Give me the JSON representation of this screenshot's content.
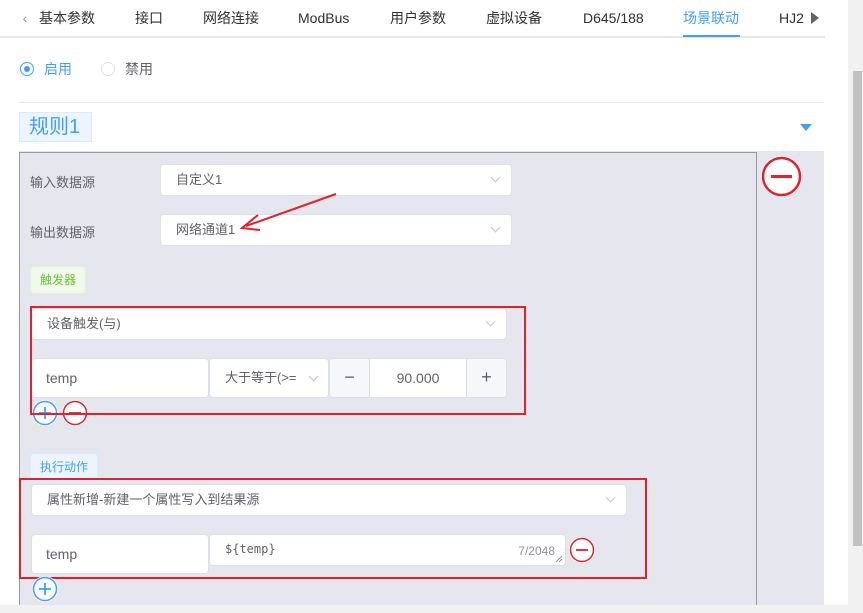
{
  "tabs": {
    "items": [
      "基本参数",
      "接口",
      "网络连接",
      "ModBus",
      "用户参数",
      "虚拟设备",
      "D645/188",
      "场景联动",
      "HJ2"
    ],
    "active": "场景联动"
  },
  "status": {
    "enabled_label": "启用",
    "disabled_label": "禁用"
  },
  "rule": {
    "title": "规则1",
    "input_source_label": "输入数据源",
    "input_source_value": "自定义1",
    "output_source_label": "输出数据源",
    "output_source_value": "网络通道1",
    "trigger": {
      "tag": "触发器",
      "type_value": "设备触发(与)",
      "field": "temp",
      "operator": "大于等于(>=",
      "value": "90.000",
      "minus_label": "−",
      "plus_label": "+"
    },
    "action": {
      "tag": "执行动作",
      "type_value": "属性新增-新建一个属性写入到结果源",
      "field": "temp",
      "expression": "${temp}",
      "char_count": "7/2048"
    }
  },
  "colors": {
    "accent": "#409eff",
    "success": "#67c23a",
    "annotation_red": "#e3202b"
  }
}
